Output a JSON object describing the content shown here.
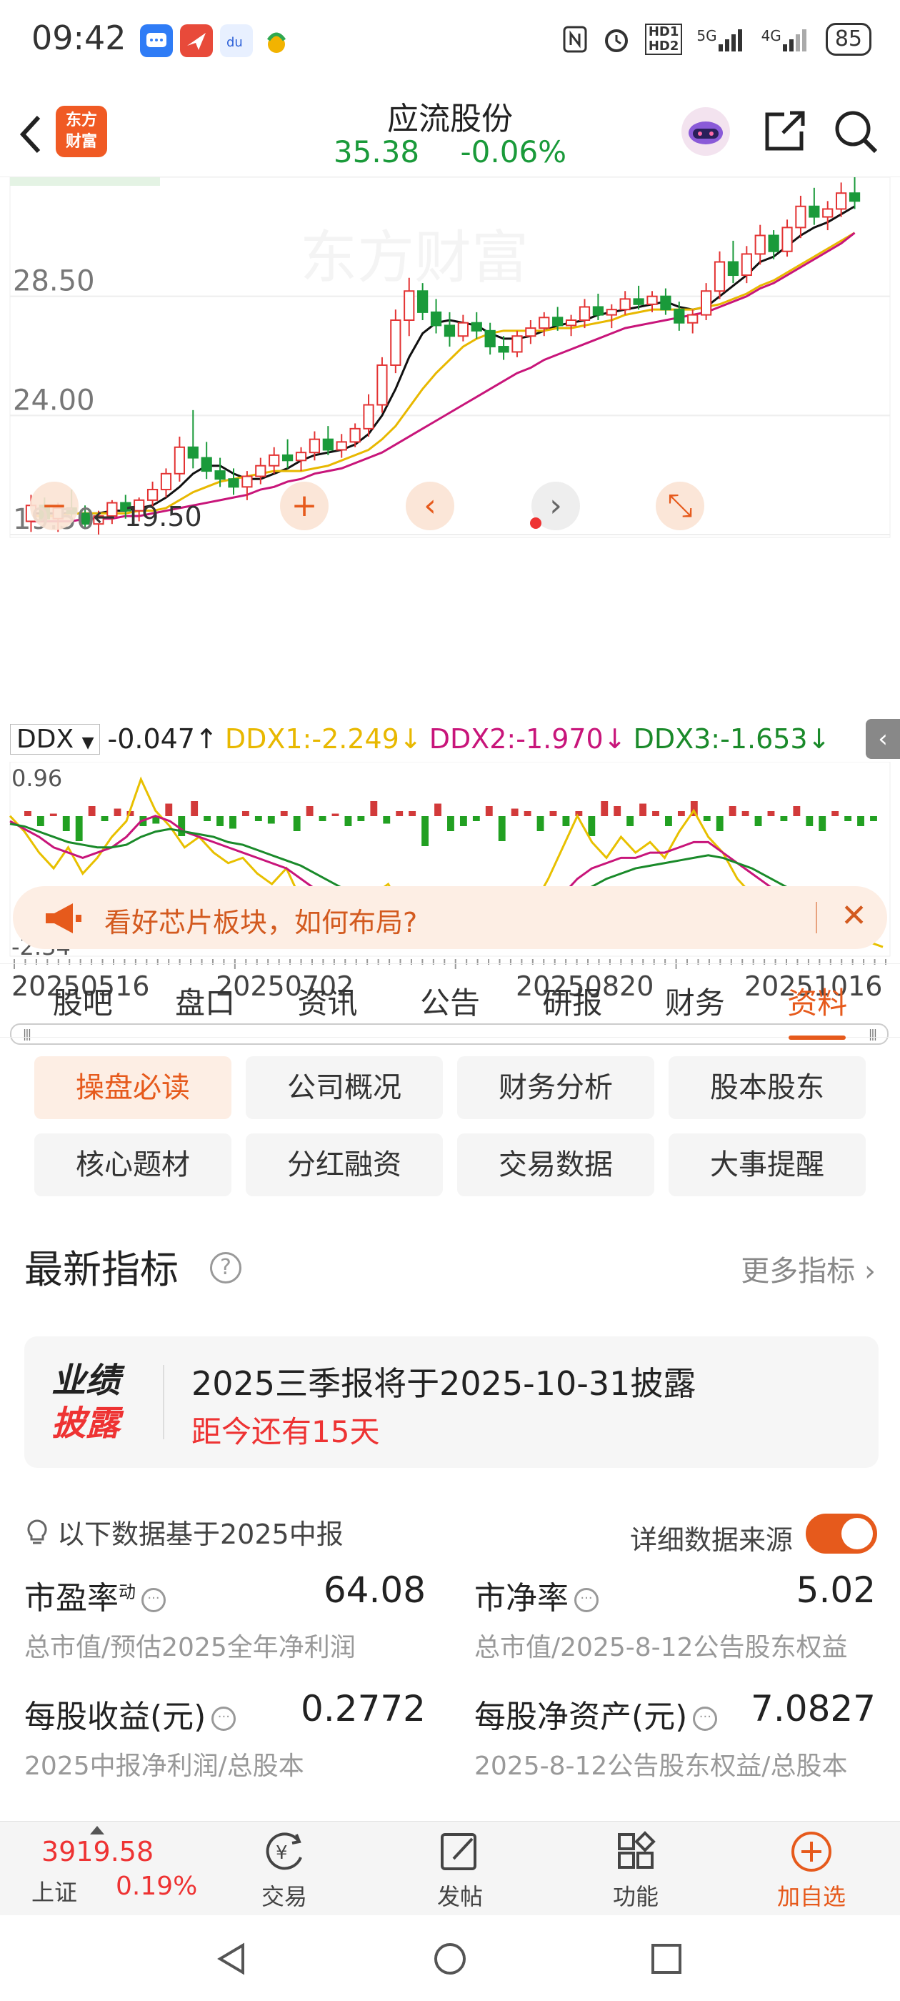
{
  "status_bar": {
    "time": "09:42",
    "signal_5g": "5G",
    "signal_4g": "4G",
    "hd1": "HD1",
    "hd2": "HD2",
    "battery": "85",
    "app_icons": [
      "message-app-icon",
      "mail-app-icon",
      "baidu-app-icon",
      "huinong-app-icon"
    ]
  },
  "header": {
    "back_icon": "chevron-left-icon",
    "logo_text_1": "东方",
    "logo_text_2": "财富",
    "stock_name": "应流股份",
    "price": "35.38",
    "change_pct": "-0.06%",
    "share_icon": "share-icon",
    "search_icon": "search-icon"
  },
  "chart_data": {
    "type": "candlestick",
    "price_axis_labels": [
      "28.50",
      "24.00",
      "19.50"
    ],
    "low_marker": "19.50",
    "ylim": [
      19.5,
      33.0
    ],
    "candles": [
      {
        "o": 20.0,
        "h": 21.0,
        "l": 19.6,
        "c": 20.6
      },
      {
        "o": 20.6,
        "h": 20.9,
        "l": 19.8,
        "c": 20.1
      },
      {
        "o": 20.1,
        "h": 20.7,
        "l": 19.6,
        "c": 20.5
      },
      {
        "o": 20.5,
        "h": 21.2,
        "l": 20.0,
        "c": 20.3
      },
      {
        "o": 20.3,
        "h": 20.6,
        "l": 19.7,
        "c": 19.9
      },
      {
        "o": 19.9,
        "h": 20.4,
        "l": 19.5,
        "c": 20.2
      },
      {
        "o": 20.2,
        "h": 20.8,
        "l": 19.9,
        "c": 20.7
      },
      {
        "o": 20.7,
        "h": 21.0,
        "l": 20.1,
        "c": 20.4
      },
      {
        "o": 20.4,
        "h": 20.9,
        "l": 20.0,
        "c": 20.8
      },
      {
        "o": 20.8,
        "h": 21.5,
        "l": 20.5,
        "c": 21.2
      },
      {
        "o": 21.2,
        "h": 22.0,
        "l": 20.9,
        "c": 21.8
      },
      {
        "o": 21.8,
        "h": 23.2,
        "l": 21.5,
        "c": 22.8
      },
      {
        "o": 22.8,
        "h": 24.2,
        "l": 22.0,
        "c": 22.4
      },
      {
        "o": 22.4,
        "h": 23.0,
        "l": 21.6,
        "c": 21.9
      },
      {
        "o": 21.9,
        "h": 22.4,
        "l": 21.3,
        "c": 21.6
      },
      {
        "o": 21.6,
        "h": 22.0,
        "l": 21.0,
        "c": 21.3
      },
      {
        "o": 21.3,
        "h": 21.9,
        "l": 20.8,
        "c": 21.7
      },
      {
        "o": 21.7,
        "h": 22.4,
        "l": 21.4,
        "c": 22.1
      },
      {
        "o": 22.1,
        "h": 22.8,
        "l": 21.8,
        "c": 22.5
      },
      {
        "o": 22.5,
        "h": 23.1,
        "l": 22.0,
        "c": 22.3
      },
      {
        "o": 22.3,
        "h": 22.8,
        "l": 21.9,
        "c": 22.6
      },
      {
        "o": 22.6,
        "h": 23.4,
        "l": 22.3,
        "c": 23.1
      },
      {
        "o": 23.1,
        "h": 23.6,
        "l": 22.5,
        "c": 22.7
      },
      {
        "o": 22.7,
        "h": 23.3,
        "l": 22.4,
        "c": 23.0
      },
      {
        "o": 23.0,
        "h": 23.7,
        "l": 22.8,
        "c": 23.5
      },
      {
        "o": 23.5,
        "h": 24.8,
        "l": 23.2,
        "c": 24.4
      },
      {
        "o": 24.4,
        "h": 26.2,
        "l": 24.1,
        "c": 25.9
      },
      {
        "o": 25.9,
        "h": 28.0,
        "l": 25.6,
        "c": 27.6
      },
      {
        "o": 27.6,
        "h": 29.2,
        "l": 27.0,
        "c": 28.7
      },
      {
        "o": 28.7,
        "h": 29.0,
        "l": 27.6,
        "c": 27.9
      },
      {
        "o": 27.9,
        "h": 28.4,
        "l": 27.1,
        "c": 27.4
      },
      {
        "o": 27.4,
        "h": 27.9,
        "l": 26.6,
        "c": 27.0
      },
      {
        "o": 27.0,
        "h": 27.8,
        "l": 26.8,
        "c": 27.5
      },
      {
        "o": 27.5,
        "h": 27.9,
        "l": 26.9,
        "c": 27.2
      },
      {
        "o": 27.2,
        "h": 27.5,
        "l": 26.3,
        "c": 26.6
      },
      {
        "o": 26.6,
        "h": 27.0,
        "l": 26.1,
        "c": 26.4
      },
      {
        "o": 26.4,
        "h": 27.2,
        "l": 26.2,
        "c": 27.0
      },
      {
        "o": 27.0,
        "h": 27.6,
        "l": 26.7,
        "c": 27.3
      },
      {
        "o": 27.3,
        "h": 27.9,
        "l": 27.0,
        "c": 27.7
      },
      {
        "o": 27.7,
        "h": 28.1,
        "l": 27.2,
        "c": 27.4
      },
      {
        "o": 27.4,
        "h": 27.8,
        "l": 27.0,
        "c": 27.6
      },
      {
        "o": 27.6,
        "h": 28.4,
        "l": 27.3,
        "c": 28.1
      },
      {
        "o": 28.1,
        "h": 28.6,
        "l": 27.6,
        "c": 27.8
      },
      {
        "o": 27.8,
        "h": 28.2,
        "l": 27.3,
        "c": 28.0
      },
      {
        "o": 28.0,
        "h": 28.7,
        "l": 27.8,
        "c": 28.4
      },
      {
        "o": 28.4,
        "h": 28.9,
        "l": 28.0,
        "c": 28.2
      },
      {
        "o": 28.2,
        "h": 28.7,
        "l": 27.9,
        "c": 28.5
      },
      {
        "o": 28.5,
        "h": 28.8,
        "l": 27.8,
        "c": 28.0
      },
      {
        "o": 28.0,
        "h": 28.3,
        "l": 27.2,
        "c": 27.5
      },
      {
        "o": 27.5,
        "h": 28.0,
        "l": 27.1,
        "c": 27.8
      },
      {
        "o": 27.8,
        "h": 29.0,
        "l": 27.6,
        "c": 28.7
      },
      {
        "o": 28.7,
        "h": 30.2,
        "l": 28.4,
        "c": 29.8
      },
      {
        "o": 29.8,
        "h": 30.6,
        "l": 29.0,
        "c": 29.3
      },
      {
        "o": 29.3,
        "h": 30.4,
        "l": 29.0,
        "c": 30.1
      },
      {
        "o": 30.1,
        "h": 31.2,
        "l": 29.7,
        "c": 30.8
      },
      {
        "o": 30.8,
        "h": 31.0,
        "l": 29.9,
        "c": 30.2
      },
      {
        "o": 30.2,
        "h": 31.4,
        "l": 30.0,
        "c": 31.1
      },
      {
        "o": 31.1,
        "h": 32.3,
        "l": 30.7,
        "c": 31.9
      },
      {
        "o": 31.9,
        "h": 32.6,
        "l": 31.2,
        "c": 31.5
      },
      {
        "o": 31.5,
        "h": 32.1,
        "l": 31.0,
        "c": 31.8
      },
      {
        "o": 31.8,
        "h": 32.8,
        "l": 31.5,
        "c": 32.4
      },
      {
        "o": 32.4,
        "h": 33.0,
        "l": 31.8,
        "c": 32.1
      }
    ],
    "ma_lines": [
      {
        "name": "MA5",
        "color": "#111111",
        "values": [
          20.3,
          20.3,
          20.3,
          20.3,
          20.3,
          20.3,
          20.4,
          20.4,
          20.5,
          20.6,
          20.9,
          21.3,
          21.8,
          22.1,
          22.1,
          21.8,
          21.6,
          21.6,
          21.8,
          22.0,
          22.3,
          22.5,
          22.6,
          22.7,
          22.9,
          23.3,
          24.0,
          25.0,
          26.2,
          27.1,
          27.5,
          27.6,
          27.5,
          27.4,
          27.1,
          26.9,
          26.9,
          27.0,
          27.2,
          27.4,
          27.5,
          27.6,
          27.8,
          27.9,
          28.0,
          28.1,
          28.2,
          28.3,
          28.1,
          28.0,
          28.1,
          28.5,
          28.9,
          29.3,
          29.8,
          30.0,
          30.4,
          30.8,
          31.1,
          31.3,
          31.6,
          31.9
        ]
      },
      {
        "name": "MA10",
        "color": "#e8b800",
        "values": [
          20.2,
          20.2,
          20.2,
          20.3,
          20.3,
          20.3,
          20.3,
          20.3,
          20.4,
          20.4,
          20.5,
          20.8,
          21.1,
          21.3,
          21.5,
          21.6,
          21.7,
          21.8,
          21.9,
          21.9,
          21.9,
          22.0,
          22.1,
          22.3,
          22.5,
          22.7,
          23.1,
          23.6,
          24.3,
          25.0,
          25.6,
          26.1,
          26.6,
          26.9,
          27.1,
          27.2,
          27.2,
          27.2,
          27.2,
          27.3,
          27.3,
          27.4,
          27.5,
          27.6,
          27.8,
          27.9,
          28.0,
          28.0,
          28.0,
          28.0,
          28.1,
          28.2,
          28.4,
          28.6,
          28.9,
          29.1,
          29.4,
          29.7,
          30.0,
          30.3,
          30.6,
          30.9
        ]
      },
      {
        "name": "MA20",
        "color": "#c8157a",
        "values": [
          20.0,
          20.0,
          20.0,
          20.0,
          20.1,
          20.1,
          20.1,
          20.2,
          20.2,
          20.3,
          20.4,
          20.5,
          20.6,
          20.7,
          20.8,
          20.9,
          21.0,
          21.2,
          21.3,
          21.5,
          21.6,
          21.8,
          21.9,
          22.0,
          22.2,
          22.4,
          22.6,
          22.9,
          23.2,
          23.5,
          23.8,
          24.1,
          24.4,
          24.7,
          25.0,
          25.3,
          25.6,
          25.8,
          26.1,
          26.3,
          26.5,
          26.7,
          26.9,
          27.1,
          27.3,
          27.4,
          27.5,
          27.6,
          27.7,
          27.8,
          27.9,
          28.1,
          28.3,
          28.5,
          28.8,
          29.0,
          29.3,
          29.6,
          29.9,
          30.2,
          30.5,
          30.9
        ]
      }
    ],
    "ddx": {
      "indicator": "DDX",
      "ddx_value": "-0.047↑",
      "ddx1_label": "DDX1:-2.249↓",
      "ddx2_label": "DDX2:-1.970↓",
      "ddx3_label": "DDX3:-1.653↓",
      "axis_top": "0.96",
      "axis_bottom": "-2.34",
      "ylim": [
        -2.34,
        0.96
      ],
      "bars": [
        0.1,
        -0.2,
        0.05,
        -0.3,
        -0.5,
        0.2,
        -0.1,
        0.15,
        0.1,
        -0.2,
        -0.15,
        0.25,
        -0.4,
        0.3,
        -0.1,
        -0.2,
        -0.25,
        0.1,
        -0.1,
        -0.15,
        0.1,
        -0.3,
        0.2,
        -0.1,
        0.05,
        -0.2,
        -0.1,
        0.3,
        -0.15,
        0.1,
        0.1,
        -0.6,
        0.25,
        -0.3,
        -0.2,
        -0.1,
        0.2,
        -0.5,
        0.15,
        0.1,
        -0.3,
        0.1,
        -0.2,
        0.1,
        -0.4,
        0.3,
        0.2,
        -0.2,
        0.25,
        0.1,
        -0.2,
        0.1,
        0.3,
        -0.1,
        -0.3,
        0.2,
        0.1,
        -0.2,
        0.1,
        -0.1,
        0.2,
        -0.2,
        -0.3,
        0.1,
        -0.1,
        -0.2,
        -0.1
      ],
      "ddx1": [
        0.2,
        -0.1,
        -0.5,
        -0.8,
        -0.4,
        -0.9,
        -0.6,
        -0.2,
        0.1,
        0.9,
        0.3,
        0.0,
        -0.4,
        -0.2,
        -0.5,
        -0.7,
        -0.6,
        -0.9,
        -1.1,
        -0.8,
        -1.4,
        -1.7,
        -2.0,
        -1.5,
        -1.8,
        -1.3,
        -1.1,
        -1.6,
        -1.9,
        -2.2,
        -1.8,
        -2.3,
        -2.0,
        -1.9,
        -2.1,
        -1.8,
        -1.5,
        -1.0,
        -0.4,
        0.2,
        -0.3,
        -0.6,
        -0.2,
        -0.5,
        -0.3,
        -0.6,
        -0.1,
        0.3,
        -0.2,
        -0.5,
        -1.0,
        -1.3,
        -1.6,
        -1.5,
        -1.9,
        -2.1,
        -1.8,
        -1.9,
        -2.0,
        -2.2,
        -2.3
      ],
      "ddx2": [
        0.1,
        -0.05,
        -0.2,
        -0.4,
        -0.5,
        -0.6,
        -0.5,
        -0.4,
        -0.2,
        0.1,
        0.2,
        0.1,
        -0.1,
        -0.2,
        -0.3,
        -0.4,
        -0.5,
        -0.6,
        -0.7,
        -0.8,
        -1.0,
        -1.2,
        -1.4,
        -1.5,
        -1.6,
        -1.5,
        -1.4,
        -1.5,
        -1.6,
        -1.8,
        -1.9,
        -2.0,
        -2.0,
        -2.0,
        -2.0,
        -1.9,
        -1.8,
        -1.6,
        -1.3,
        -1.0,
        -0.8,
        -0.7,
        -0.6,
        -0.6,
        -0.5,
        -0.5,
        -0.4,
        -0.3,
        -0.3,
        -0.5,
        -0.7,
        -0.9,
        -1.1,
        -1.3,
        -1.5,
        -1.6,
        -1.7,
        -1.8,
        -1.9,
        -2.0,
        -2.0
      ],
      "ddx3": [
        0.05,
        0.0,
        -0.1,
        -0.2,
        -0.3,
        -0.35,
        -0.4,
        -0.4,
        -0.35,
        -0.2,
        -0.1,
        -0.05,
        -0.1,
        -0.15,
        -0.2,
        -0.3,
        -0.35,
        -0.45,
        -0.55,
        -0.65,
        -0.75,
        -0.9,
        -1.05,
        -1.2,
        -1.3,
        -1.4,
        -1.45,
        -1.5,
        -1.55,
        -1.65,
        -1.75,
        -1.85,
        -1.9,
        -1.95,
        -1.95,
        -1.9,
        -1.8,
        -1.65,
        -1.5,
        -1.3,
        -1.15,
        -1.0,
        -0.9,
        -0.8,
        -0.75,
        -0.7,
        -0.65,
        -0.6,
        -0.55,
        -0.6,
        -0.7,
        -0.8,
        -0.95,
        -1.1,
        -1.25,
        -1.35,
        -1.45,
        -1.55,
        -1.6,
        -1.65,
        -1.7
      ]
    },
    "x_dates": [
      "20250516",
      "20250702",
      "20250820",
      "20251016"
    ],
    "grid": true
  },
  "chart_controls": {
    "zoom_out": "−",
    "zoom_in": "+",
    "prev": "‹",
    "next": "›",
    "expand_icon": "expand-icon"
  },
  "notice": {
    "icon": "megaphone-icon",
    "text": "看好芯片板块，如何布局?",
    "close": "✕"
  },
  "tabs": [
    {
      "label": "股吧",
      "active": false
    },
    {
      "label": "盘口",
      "active": false
    },
    {
      "label": "资讯",
      "active": false
    },
    {
      "label": "公告",
      "active": false
    },
    {
      "label": "研报",
      "active": false
    },
    {
      "label": "财务",
      "active": false
    },
    {
      "label": "资料",
      "active": true
    }
  ],
  "sub_buttons": [
    {
      "label": "操盘必读",
      "active": true
    },
    {
      "label": "公司概况",
      "active": false
    },
    {
      "label": "财务分析",
      "active": false
    },
    {
      "label": "股本股东",
      "active": false
    },
    {
      "label": "核心题材",
      "active": false
    },
    {
      "label": "分红融资",
      "active": false
    },
    {
      "label": "交易数据",
      "active": false
    },
    {
      "label": "大事提醒",
      "active": false
    }
  ],
  "indicators": {
    "title": "最新指标",
    "help": "?",
    "more": "更多指标 ›",
    "report_badge_1": "业绩",
    "report_badge_2": "披露",
    "report_main": "2025三季报将于2025-10-31披露",
    "report_sub": "距今还有15天",
    "basis": "以下数据基于2025中报",
    "source_label": "详细数据来源",
    "source_toggle_on": true,
    "metrics": [
      {
        "label": "市盈率",
        "sup": "动",
        "value": "64.08",
        "desc": "总市值/预估2025全年净利润"
      },
      {
        "label": "市净率",
        "sup": "",
        "value": "5.02",
        "desc": "总市值/2025-8-12公告股东权益"
      },
      {
        "label": "每股收益(元)",
        "sup": "",
        "value": "0.2772",
        "desc": "2025中报净利润/总股本"
      },
      {
        "label": "每股净资产(元)",
        "sup": "",
        "value": "7.0827",
        "desc": "2025-8-12公告股东权益/总股本"
      }
    ]
  },
  "bottom_bar": {
    "index_value": "3919.58",
    "index_name": "上证",
    "index_change": "0.19%",
    "items": [
      {
        "label": "交易",
        "icon": "trade-yen-icon"
      },
      {
        "label": "发帖",
        "icon": "edit-post-icon"
      },
      {
        "label": "功能",
        "icon": "grid-apps-icon"
      },
      {
        "label": "加自选",
        "icon": "add-circle-icon"
      }
    ]
  },
  "colors": {
    "accent": "#e65a1c",
    "rise": "#e33333",
    "fall": "#1a9a3a"
  }
}
